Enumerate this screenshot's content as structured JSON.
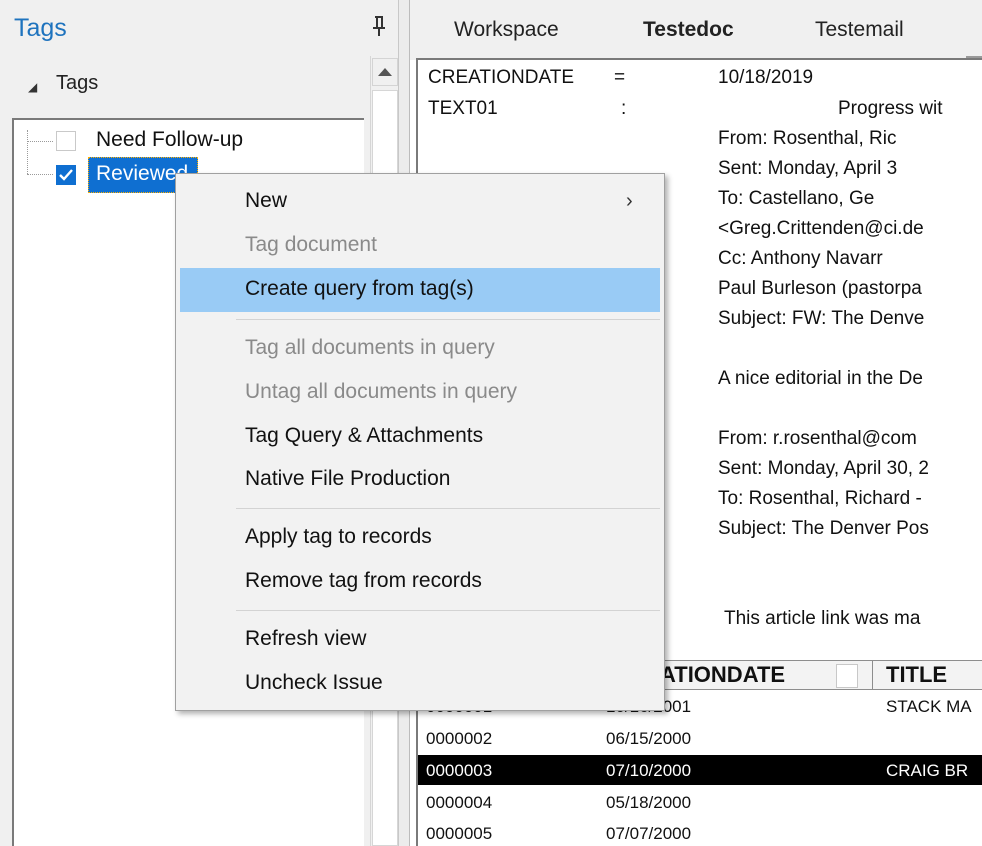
{
  "tags_pane": {
    "title": "Tags",
    "root_label": "Tags",
    "items": [
      {
        "label": "Need Follow-up",
        "checked": false
      },
      {
        "label": "Reviewed",
        "checked": true
      }
    ]
  },
  "tabs": [
    "Workspace",
    "Testedoc",
    "Testemail"
  ],
  "active_tab": "Testedoc",
  "document": {
    "field1_name": "CREATIONDATE",
    "field1_sep": "=",
    "field1_value": "10/18/2019",
    "field2_name": "TEXT01",
    "field2_sep": ":",
    "lines": [
      "Progress wit",
      "From:     Rosenthal, Ric",
      "Sent:      Monday, April 3",
      "To:         Castellano, Ge",
      "<Greg.Crittenden@ci.de",
      "Cc:         Anthony Navarr",
      "Paul Burleson (pastorpa",
      "Subject: FW: The Denve",
      "A nice editorial in the De",
      "From: r.rosenthal@com",
      "Sent: Monday, April 30, 2",
      "To: Rosenthal, Richard -",
      "Subject: The Denver Pos",
      "This article link was ma"
    ]
  },
  "grid": {
    "headers": [
      "ATIONDATE",
      "TITLE"
    ],
    "rows": [
      {
        "id": "0000001",
        "date": "10/16/2001",
        "title": "STACK MA"
      },
      {
        "id": "0000002",
        "date": "06/15/2000",
        "title": ""
      },
      {
        "id": "0000003",
        "date": "07/10/2000",
        "title": "CRAIG BR"
      },
      {
        "id": "0000004",
        "date": "05/18/2000",
        "title": ""
      },
      {
        "id": "0000005",
        "date": "07/07/2000",
        "title": ""
      }
    ],
    "selected_row_index": 2
  },
  "context_menu": {
    "items": [
      {
        "label": "New",
        "enabled": true,
        "submenu": true
      },
      {
        "label": "Tag document",
        "enabled": false
      },
      {
        "label": "Create query from tag(s)",
        "enabled": true,
        "highlighted": true
      },
      {
        "label": "Tag all documents in query",
        "enabled": false
      },
      {
        "label": "Untag all documents in query",
        "enabled": false
      },
      {
        "label": "Tag Query & Attachments",
        "enabled": true
      },
      {
        "label": "Native File Production",
        "enabled": true
      },
      {
        "label": "Apply tag to records",
        "enabled": true
      },
      {
        "label": "Remove tag from records",
        "enabled": true
      },
      {
        "label": "Refresh view",
        "enabled": true
      },
      {
        "label": "Uncheck Issue",
        "enabled": true
      }
    ],
    "submenu_arrow": "›"
  },
  "colors": {
    "accent": "#1e73be",
    "selection": "#0f6fd1",
    "menu_highlight": "#99cbf5",
    "disabled_text": "#8a8a8a"
  },
  "icons": {
    "pin": "pin-icon",
    "collapse": "collapse-arrow-icon",
    "scroll_up": "scroll-up-icon",
    "submenu": "chevron-right-icon",
    "check": "checkmark-icon"
  }
}
